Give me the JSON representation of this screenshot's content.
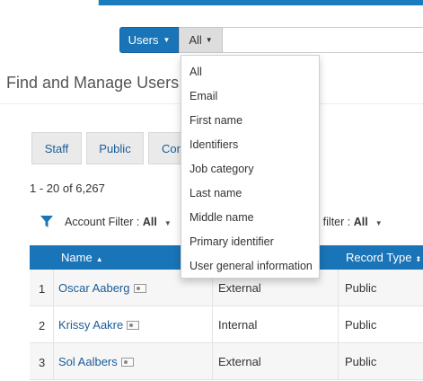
{
  "search": {
    "scope_label": "Users",
    "field_label": "All",
    "options": [
      "All",
      "Email",
      "First name",
      "Identifiers",
      "Job category",
      "Last name",
      "Middle name",
      "Primary identifier",
      "User general information"
    ]
  },
  "page": {
    "title": "Find and Manage Users"
  },
  "tabs": [
    {
      "label": "Staff"
    },
    {
      "label": "Public"
    },
    {
      "label": "Con"
    }
  ],
  "results": {
    "count_text": "1 - 20 of 6,267"
  },
  "filters": {
    "account_label": "Account Filter : ",
    "account_value": "All",
    "status_label": "us filter : ",
    "status_value": "All"
  },
  "table": {
    "columns": {
      "name": "Name",
      "record_type": "Record Type"
    },
    "rows": [
      {
        "num": "1",
        "name": "Oscar Aaberg",
        "type": "External",
        "record": "Public"
      },
      {
        "num": "2",
        "name": "Krissy Aakre",
        "type": "Internal",
        "record": "Public"
      },
      {
        "num": "3",
        "name": "Sol Aalbers",
        "type": "External",
        "record": "Public"
      }
    ]
  },
  "colors": {
    "primary": "#1a74b8",
    "link": "#1a5d98"
  }
}
